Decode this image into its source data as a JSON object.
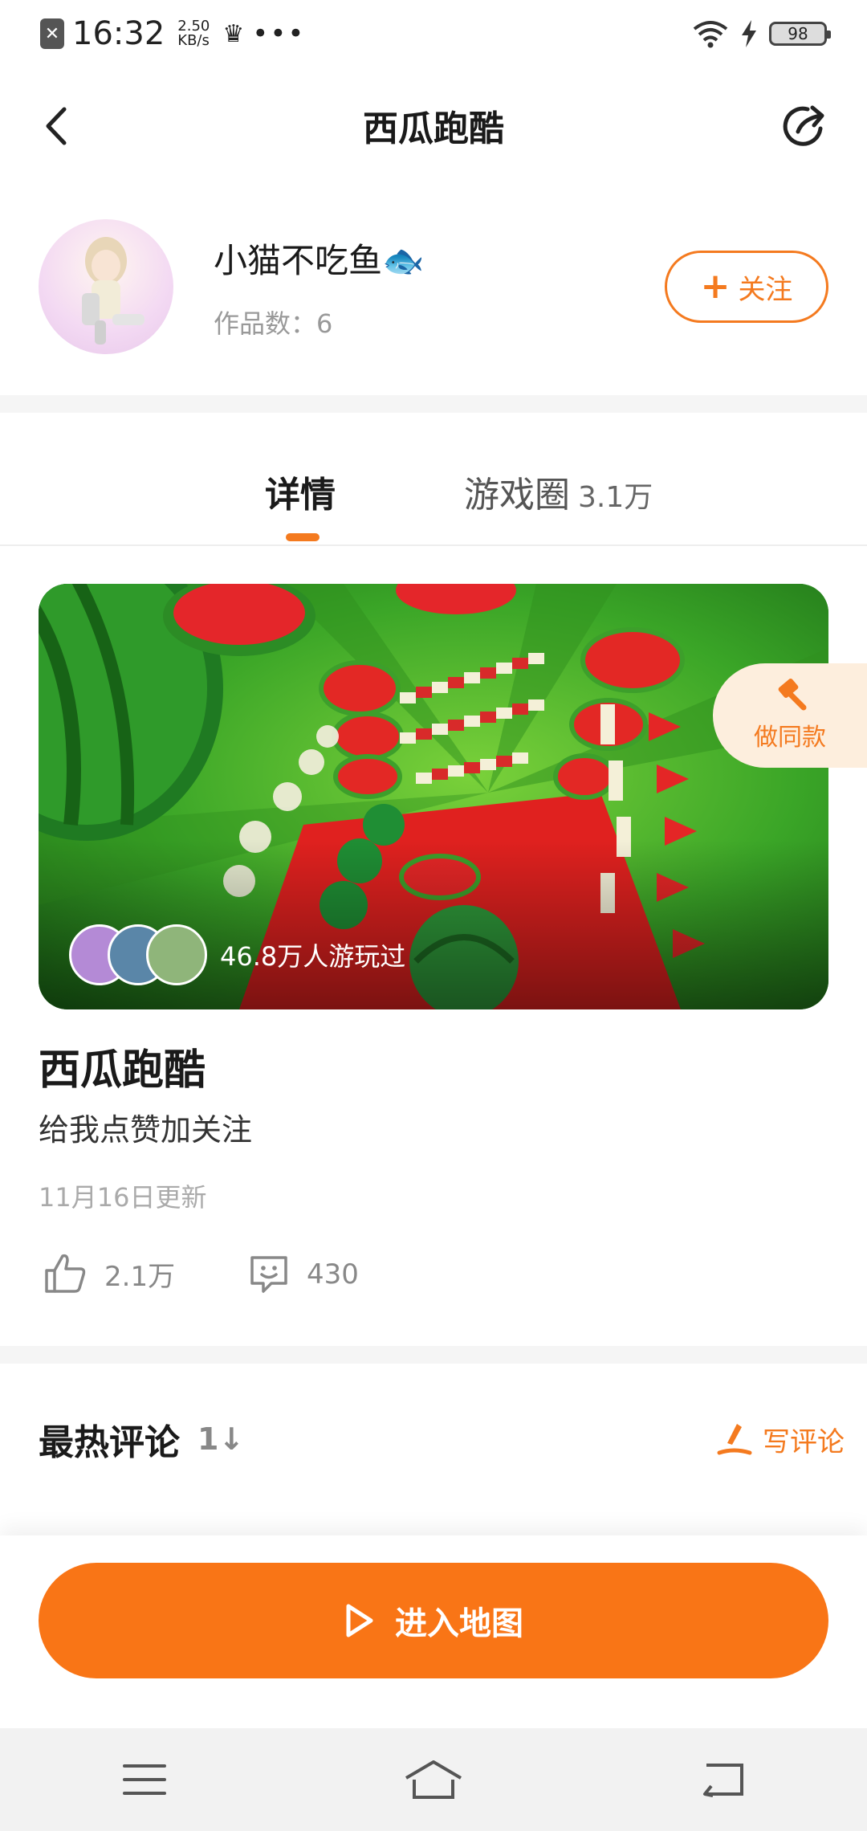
{
  "status_bar": {
    "time": "16:32",
    "speed_value": "2.50",
    "speed_unit": "KB/s",
    "battery": "98"
  },
  "header": {
    "title": "西瓜跑酷"
  },
  "author": {
    "name": "小猫不吃鱼🐟",
    "works_label": "作品数：6",
    "follow_label": "关注"
  },
  "tabs": [
    {
      "label": "详情",
      "active": true
    },
    {
      "label": "游戏圈",
      "count": "3.1万",
      "active": false
    }
  ],
  "banner": {
    "players_text": "46.8万人游玩过"
  },
  "make_same": {
    "label": "做同款"
  },
  "game": {
    "title": "西瓜跑酷",
    "description": "给我点赞加关注",
    "updated": "11月16日更新",
    "likes": "2.1万",
    "comments": "430"
  },
  "hot_comments": {
    "title": "最热评论",
    "sort_label": "1↓",
    "write_label": "写评论"
  },
  "action": {
    "enter_label": "进入地图"
  },
  "colors": {
    "accent": "#f47a1f",
    "button": "#f97516",
    "make_same_bg": "#fdeedd"
  }
}
